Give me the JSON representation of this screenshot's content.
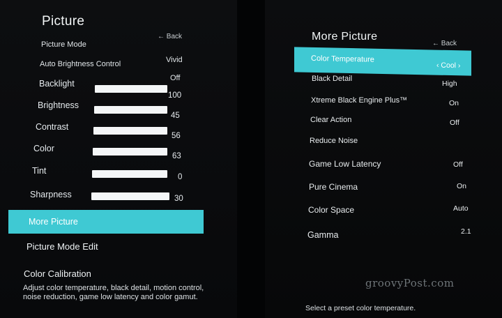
{
  "left": {
    "title": "Picture",
    "back_label": "← Back",
    "picture_mode": {
      "label": "Picture Mode",
      "value": "Vivid"
    },
    "auto_brightness": {
      "label": "Auto Brightness Control",
      "value": "Off"
    },
    "sliders": [
      {
        "label": "Backlight",
        "value": "100",
        "level": 1.0
      },
      {
        "label": "Brightness",
        "value": "45",
        "level": 0.45
      },
      {
        "label": "Contrast",
        "value": "56",
        "level": 0.56
      },
      {
        "label": "Color",
        "value": "63",
        "level": 0.63
      },
      {
        "label": "Tint",
        "value": "0",
        "level": 0.0
      },
      {
        "label": "Sharpness",
        "value": "30",
        "level": 0.3
      }
    ],
    "menu": [
      {
        "label": "More Picture",
        "selected": true
      },
      {
        "label": "Picture Mode Edit",
        "selected": false
      },
      {
        "label": "Color Calibration",
        "selected": false
      }
    ],
    "description": "Adjust color temperature, black detail, motion control, noise reduction, game low latency and color gamut."
  },
  "right": {
    "title": "More Picture",
    "back_label": "← Back",
    "items": [
      {
        "label": "Color Temperature",
        "value": "‹ Cool ›",
        "selected": true
      },
      {
        "label": "Black Detail",
        "value": "High"
      },
      {
        "label": "Xtreme Black Engine Plus™",
        "value": "On"
      },
      {
        "label": "Clear Action",
        "value": "Off"
      },
      {
        "label": "Reduce Noise",
        "value": ""
      },
      {
        "label": "Game Low Latency",
        "value": "Off"
      },
      {
        "label": "Pure Cinema",
        "value": "On"
      },
      {
        "label": "Color Space",
        "value": "Auto"
      },
      {
        "label": "Gamma",
        "value": "2.1"
      }
    ],
    "description": "Select a preset color temperature."
  },
  "watermark": "groovyPost.com",
  "colors": {
    "highlight": "#3fc9d3",
    "background": "#0b0c0e",
    "slider": "#f4f6f7"
  }
}
